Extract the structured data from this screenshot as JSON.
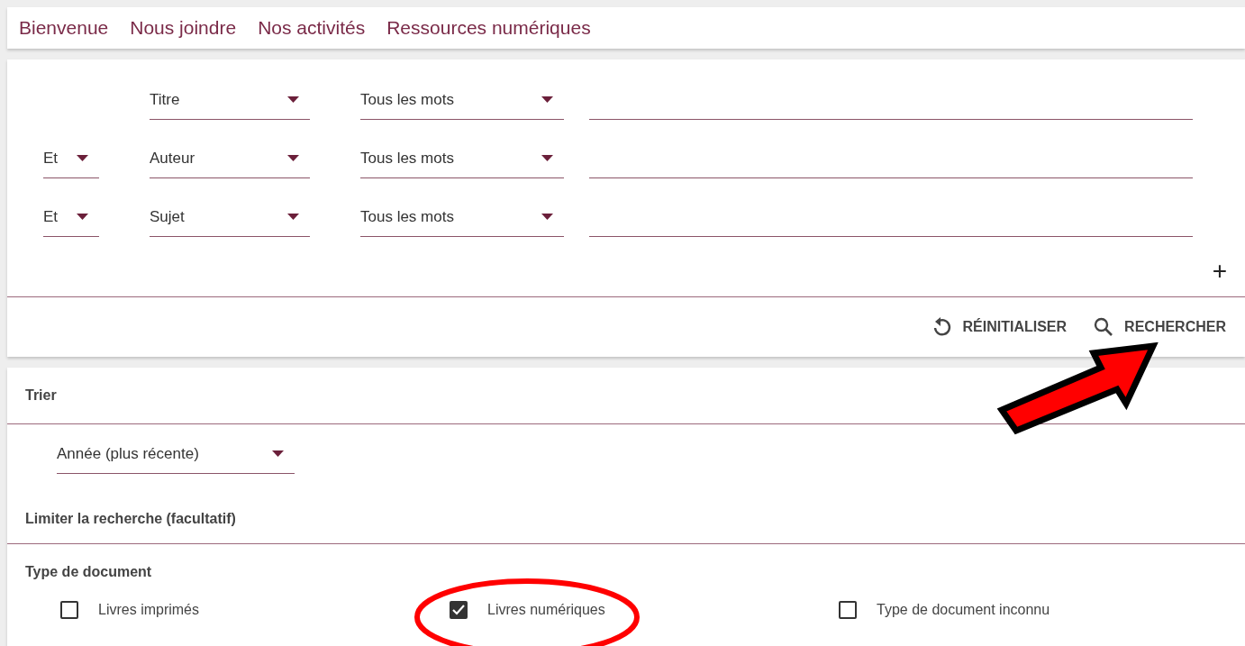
{
  "nav": {
    "links": [
      "Bienvenue",
      "Nous joindre",
      "Nos activités",
      "Ressources numériques"
    ]
  },
  "search": {
    "rows": [
      {
        "field": "Titre",
        "match": "Tous les mots"
      },
      {
        "connector": "Et",
        "field": "Auteur",
        "match": "Tous les mots"
      },
      {
        "connector": "Et",
        "field": "Sujet",
        "match": "Tous les mots"
      }
    ],
    "add": "+",
    "buttons": [
      {
        "kind": "reset",
        "label": "RÉINITIALISER"
      },
      {
        "kind": "search",
        "label": "RECHERCHER"
      }
    ]
  },
  "sort": {
    "title": "Trier",
    "value": "Année (plus récente)"
  },
  "limit": {
    "title": "Limiter la recherche (facultatif)",
    "group": "Type de document",
    "options": [
      {
        "label": "Livres imprimés",
        "checked": false
      },
      {
        "label": "Livres numériques",
        "checked": true
      },
      {
        "label": "Type de document inconnu",
        "checked": false
      }
    ]
  },
  "annotations": [
    {
      "kind": "arrow"
    },
    {
      "kind": "ellipse"
    }
  ]
}
